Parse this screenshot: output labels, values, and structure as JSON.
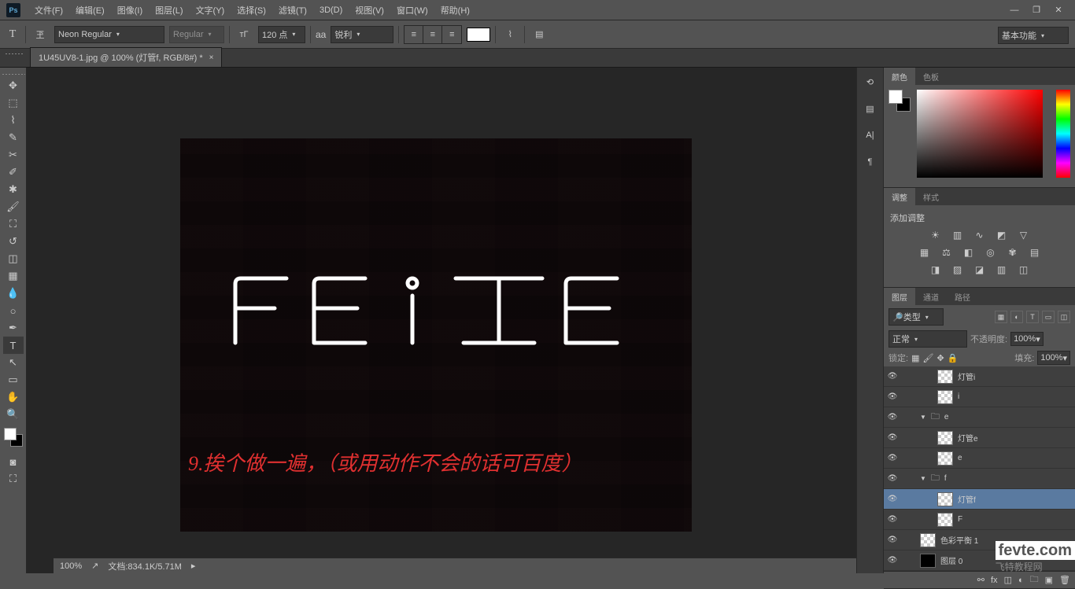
{
  "menubar": {
    "items": [
      "文件(F)",
      "编辑(E)",
      "图像(I)",
      "图层(L)",
      "文字(Y)",
      "选择(S)",
      "滤镜(T)",
      "3D(D)",
      "视图(V)",
      "窗口(W)",
      "帮助(H)"
    ]
  },
  "optbar": {
    "font": "Neon Regular",
    "weight": "Regular",
    "size": "120 点",
    "aa_label": "aa",
    "aa_value": "锐利",
    "swatch_color": "#ffffff"
  },
  "workspace_switch": "基本功能",
  "tab": {
    "title": "1U45UV8-1.jpg @ 100% (灯管f, RGB/8#) *"
  },
  "canvas": {
    "neon": "FEiTE",
    "red": "9.挨个做一遍，（或用动作不会的话可百度）"
  },
  "statusbar": {
    "zoom": "100%",
    "doc": "文档:834.1K/5.71M"
  },
  "panels": {
    "color_tabs": [
      "颜色",
      "色板"
    ],
    "adjust_tabs": [
      "调整",
      "样式"
    ],
    "adjust_label": "添加调整",
    "layer_tabs": [
      "图层",
      "通道",
      "路径"
    ],
    "filter_label": "类型",
    "blend": "正常",
    "opacity_label": "不透明度:",
    "opacity": "100%",
    "lock_label": "锁定:",
    "fill_label": "填充:",
    "fill": "100%",
    "layers": [
      {
        "name": "灯管i",
        "eye": true,
        "indent": 2,
        "thumb": "t"
      },
      {
        "name": "i",
        "eye": true,
        "indent": 2,
        "thumb": "t"
      },
      {
        "name": "e",
        "eye": true,
        "indent": 1,
        "fold": "▼",
        "thumb": "folder"
      },
      {
        "name": "灯管e",
        "eye": true,
        "indent": 2,
        "thumb": "t"
      },
      {
        "name": "e",
        "eye": true,
        "indent": 2,
        "thumb": "t"
      },
      {
        "name": "f",
        "eye": true,
        "indent": 1,
        "fold": "▼",
        "thumb": "folder"
      },
      {
        "name": "灯管f",
        "eye": true,
        "indent": 2,
        "thumb": "t",
        "sel": true
      },
      {
        "name": "F",
        "eye": true,
        "indent": 2,
        "thumb": "t"
      },
      {
        "name": "色彩平衡 1",
        "eye": true,
        "indent": 1,
        "thumb": "adj"
      },
      {
        "name": "图层 0",
        "eye": true,
        "indent": 1,
        "thumb": "dark"
      }
    ]
  },
  "watermark": {
    "logo": "fevte.com",
    "sub": "飞特教程网"
  }
}
